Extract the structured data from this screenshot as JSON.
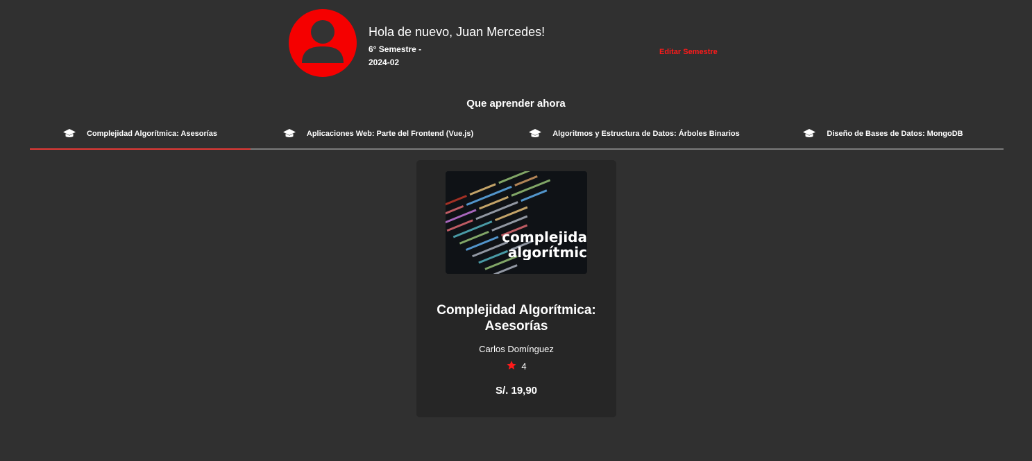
{
  "profile": {
    "greeting": "Hola de nuevo, Juan Mercedes!",
    "semester_line": "6° Semestre -",
    "period": "2024-02",
    "edit_label": "Editar Semestre",
    "avatar_color": "#f50000",
    "avatar_icon": "user-silhouette-icon"
  },
  "section": {
    "title": "Que aprender ahora"
  },
  "tabs": [
    {
      "label": "Complejidad Algorítmica: Asesorías",
      "icon": "graduation-cap-icon",
      "active": true
    },
    {
      "label": "Aplicaciones Web: Parte del Frontend (Vue.js)",
      "icon": "graduation-cap-icon",
      "active": false
    },
    {
      "label": "Algoritmos y Estructura de Datos: Árboles Binarios",
      "icon": "graduation-cap-icon",
      "active": false
    },
    {
      "label": "Diseño de Bases de Datos: MongoDB",
      "icon": "graduation-cap-icon",
      "active": false
    }
  ],
  "course_card": {
    "image_text_line1": "complejida",
    "image_text_line2": "algorítmic",
    "title_line1": "Complejidad Algorítmica:",
    "title_line2": "Asesorías",
    "author": "Carlos Domínguez",
    "rating": "4",
    "rating_icon": "star-icon",
    "price": "S/. 19,90"
  },
  "colors": {
    "background": "#303030",
    "card": "#262626",
    "accent": "#e53935",
    "link": "#ff1a1a"
  }
}
